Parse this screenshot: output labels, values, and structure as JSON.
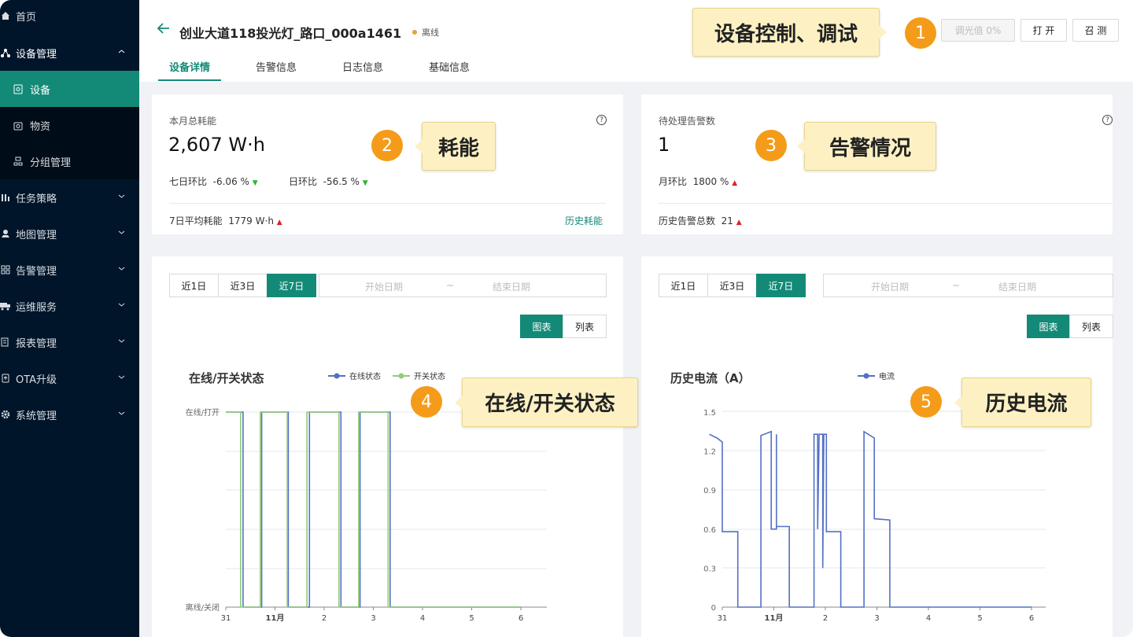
{
  "sidebar": {
    "items": [
      {
        "label": "首页",
        "icon": "home-icon"
      },
      {
        "label": "设备管理",
        "icon": "network-icon"
      },
      {
        "label": "设备",
        "icon": "device-icon"
      },
      {
        "label": "物资",
        "icon": "box-icon"
      },
      {
        "label": "分组管理",
        "icon": "group-icon"
      },
      {
        "label": "任务策略",
        "icon": "task-icon"
      },
      {
        "label": "地图管理",
        "icon": "map-icon"
      },
      {
        "label": "告警管理",
        "icon": "alarm-icon"
      },
      {
        "label": "运维服务",
        "icon": "truck-icon"
      },
      {
        "label": "报表管理",
        "icon": "report-icon"
      },
      {
        "label": "OTA升级",
        "icon": "ota-icon"
      },
      {
        "label": "系统管理",
        "icon": "settings-icon"
      }
    ]
  },
  "header": {
    "title": "创业大道118投光灯_路口_000a1461",
    "status": "离线",
    "status_color": "#e3a23a",
    "buttons": {
      "dim": "调光值 0%",
      "open": "打 开",
      "measure": "召 测"
    },
    "tabs": [
      "设备详情",
      "告警信息",
      "日志信息",
      "基础信息"
    ]
  },
  "energy": {
    "label": "本月总耗能",
    "value": "2,607 W·h",
    "wow_label": "七日环比",
    "wow_value": "-6.06 %",
    "dod_label": "日环比",
    "dod_value": "-56.5 %",
    "avg_label": "7日平均耗能",
    "avg_value": "1779 W·h",
    "history_link": "历史耗能"
  },
  "alarm": {
    "label": "待处理告警数",
    "value": "1",
    "mom_label": "月环比",
    "mom_value": "1800 %",
    "total_label": "历史告警总数",
    "total_value": "21"
  },
  "filters": {
    "ranges": [
      "近1日",
      "近3日",
      "近7日"
    ],
    "start_placeholder": "开始日期",
    "sep": "~",
    "end_placeholder": "结束日期",
    "view_chart": "图表",
    "view_list": "列表"
  },
  "callouts": [
    {
      "num": "1",
      "text": "设备控制、调试"
    },
    {
      "num": "2",
      "text": "耗能"
    },
    {
      "num": "3",
      "text": "告警情况"
    },
    {
      "num": "4",
      "text": "在线/开关状态"
    },
    {
      "num": "5",
      "text": "历史电流"
    }
  ],
  "chart_data": [
    {
      "type": "line",
      "title": "在线/开关状态",
      "x_ticks": [
        "31",
        "11月",
        "2",
        "3",
        "4",
        "5",
        "6"
      ],
      "y_ticks": [
        "离线/关闭",
        "在线/打开"
      ],
      "series": [
        {
          "name": "在线状态",
          "color": "#5470c6",
          "points": [
            [
              0,
              1
            ],
            [
              0.35,
              1
            ],
            [
              0.35,
              0
            ],
            [
              0.73,
              0
            ],
            [
              0.73,
              1
            ],
            [
              1.27,
              1
            ],
            [
              1.27,
              0
            ],
            [
              1.7,
              0
            ],
            [
              1.7,
              1
            ],
            [
              2.34,
              1
            ],
            [
              2.34,
              0
            ],
            [
              2.73,
              0
            ],
            [
              2.73,
              1
            ],
            [
              3.34,
              1
            ],
            [
              3.34,
              0
            ],
            [
              6,
              0
            ]
          ]
        },
        {
          "name": "开关状态",
          "color": "#91cc75",
          "points": [
            [
              0,
              1
            ],
            [
              0.3,
              1
            ],
            [
              0.3,
              0
            ],
            [
              0.7,
              0
            ],
            [
              0.7,
              1
            ],
            [
              1.25,
              1
            ],
            [
              1.25,
              0
            ],
            [
              1.65,
              0
            ],
            [
              1.65,
              1
            ],
            [
              2.3,
              1
            ],
            [
              2.3,
              0
            ],
            [
              2.7,
              0
            ],
            [
              2.7,
              1
            ],
            [
              3.3,
              1
            ],
            [
              3.3,
              0
            ],
            [
              6,
              0
            ]
          ]
        }
      ]
    },
    {
      "type": "line",
      "title": "历史电流（A）",
      "x_ticks": [
        "31",
        "11月",
        "2",
        "3",
        "4",
        "5",
        "6"
      ],
      "ylim": [
        0,
        1.5
      ],
      "y_ticks": [
        "0",
        "0.3",
        "0.6",
        "0.9",
        "1.2",
        "1.5"
      ],
      "series": [
        {
          "name": "电流",
          "color": "#5470c6",
          "points": [
            [
              -0.25,
              1.33
            ],
            [
              -0.1,
              1.3
            ],
            [
              0,
              1.27
            ],
            [
              0,
              0.58
            ],
            [
              0.3,
              0.58
            ],
            [
              0.3,
              0
            ],
            [
              0.75,
              0
            ],
            [
              0.75,
              1.32
            ],
            [
              0.95,
              1.35
            ],
            [
              0.95,
              0.6
            ],
            [
              1.05,
              0.6
            ],
            [
              1.05,
              1.33
            ],
            [
              1.05,
              0.62
            ],
            [
              1.3,
              0.62
            ],
            [
              1.3,
              0
            ],
            [
              1.78,
              0
            ],
            [
              1.78,
              1.33
            ],
            [
              1.85,
              1.33
            ],
            [
              1.85,
              0.6
            ],
            [
              1.88,
              1.33
            ],
            [
              1.95,
              1.33
            ],
            [
              1.95,
              0.3
            ],
            [
              1.97,
              1.33
            ],
            [
              2.02,
              1.33
            ],
            [
              2.02,
              0.58
            ],
            [
              2.3,
              0.58
            ],
            [
              2.3,
              0
            ],
            [
              2.75,
              0
            ],
            [
              2.75,
              1.35
            ],
            [
              2.95,
              1.3
            ],
            [
              2.95,
              0.68
            ],
            [
              3.25,
              0.67
            ],
            [
              3.25,
              0
            ],
            [
              6,
              0
            ]
          ]
        }
      ]
    }
  ]
}
